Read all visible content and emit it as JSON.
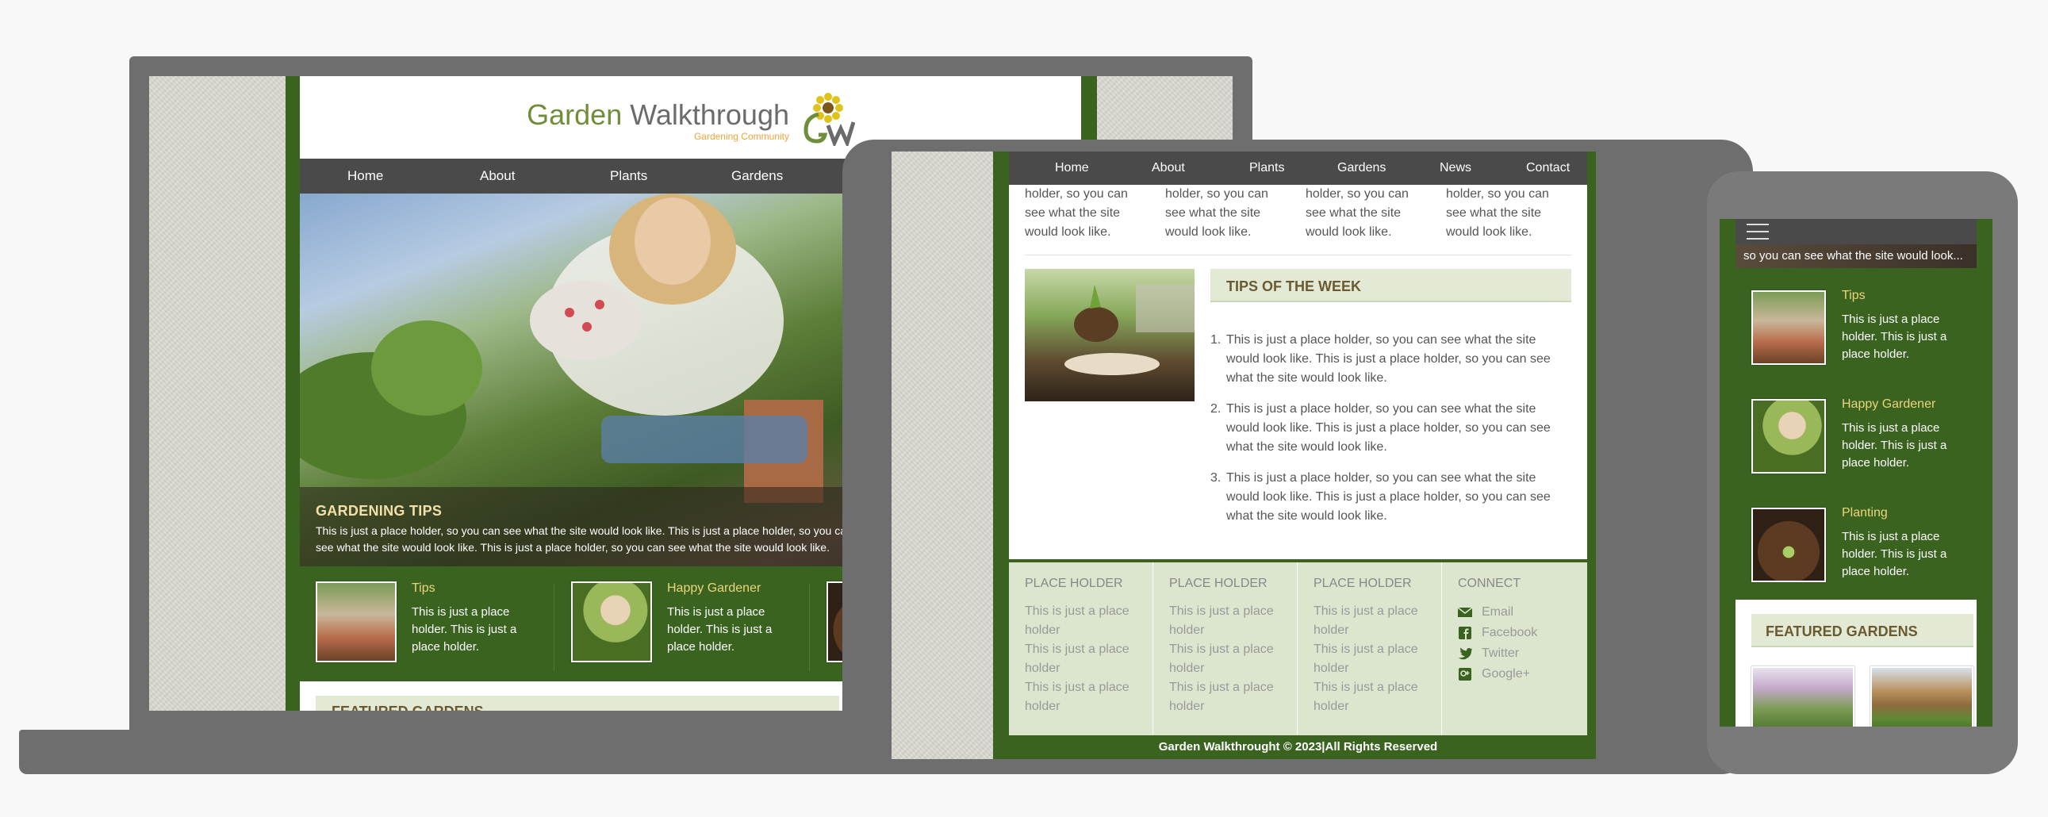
{
  "laptop": {
    "brand_word1": "Garden",
    "brand_word2": "Walkthrough",
    "tagline": "Gardening Community",
    "logo_text": "GW",
    "nav": [
      "Home",
      "About",
      "Plants",
      "Gardens"
    ],
    "hero": {
      "title": "GARDENING TIPS",
      "text": "This is just a place holder, so you can see what the site would look like. This is just a place holder, so you can see what the site would look like. This is just a place holder, so you can see what the site would look like."
    },
    "features": [
      {
        "title": "Tips",
        "text": "This is just a place holder. This is just a place holder."
      },
      {
        "title": "Happy Gardener",
        "text": "This is just a place holder. This is just a place holder."
      }
    ],
    "featured_title": "FEATURED GARDENS"
  },
  "tablet": {
    "nav": [
      "Home",
      "About",
      "Plants",
      "Gardens",
      "News",
      "Contact"
    ],
    "column_text": "holder, so you can see what the site would look like.",
    "tips_title": "TIPS OF THE WEEK",
    "tips": [
      {
        "num": "1.",
        "text": "This is just a place holder, so you can see what the site would look like. This is just a place holder, so you can see what the site would look like."
      },
      {
        "num": "2.",
        "text": "This is just a place holder, so you can see what the site would look like. This is just a place holder, so you can see what the site would look like."
      },
      {
        "num": "3.",
        "text": "This is just a place holder, so you can see what the site would look like. This is just a place holder, so you can see what the site would look like."
      }
    ],
    "footer": {
      "col_heading": "PLACE HOLDER",
      "col_line": "This is just a place holder",
      "connect_heading": "CONNECT",
      "links": [
        "Email",
        "Facebook",
        "Twitter",
        "Google+"
      ]
    },
    "copyright": "Garden Walkthrought © 2023|All Rights Reserved"
  },
  "phone": {
    "strip_text": "so you can see what the site would look...",
    "features": [
      {
        "title": "Tips",
        "text": "This is just a place holder. This is just a place holder."
      },
      {
        "title": "Happy Gardener",
        "text": "This is just a place holder. This is just a place holder."
      },
      {
        "title": "Planting",
        "text": "This is just a place holder. This is just a place holder."
      }
    ],
    "featured_title": "FEATURED GARDENS"
  },
  "colors": {
    "site_green": "#3a6320",
    "nav_gray": "#4a4a4a",
    "accent_gold": "#ecd47a",
    "heading_brown": "#6b5a2f",
    "device_frame": "#6e6e6e"
  }
}
